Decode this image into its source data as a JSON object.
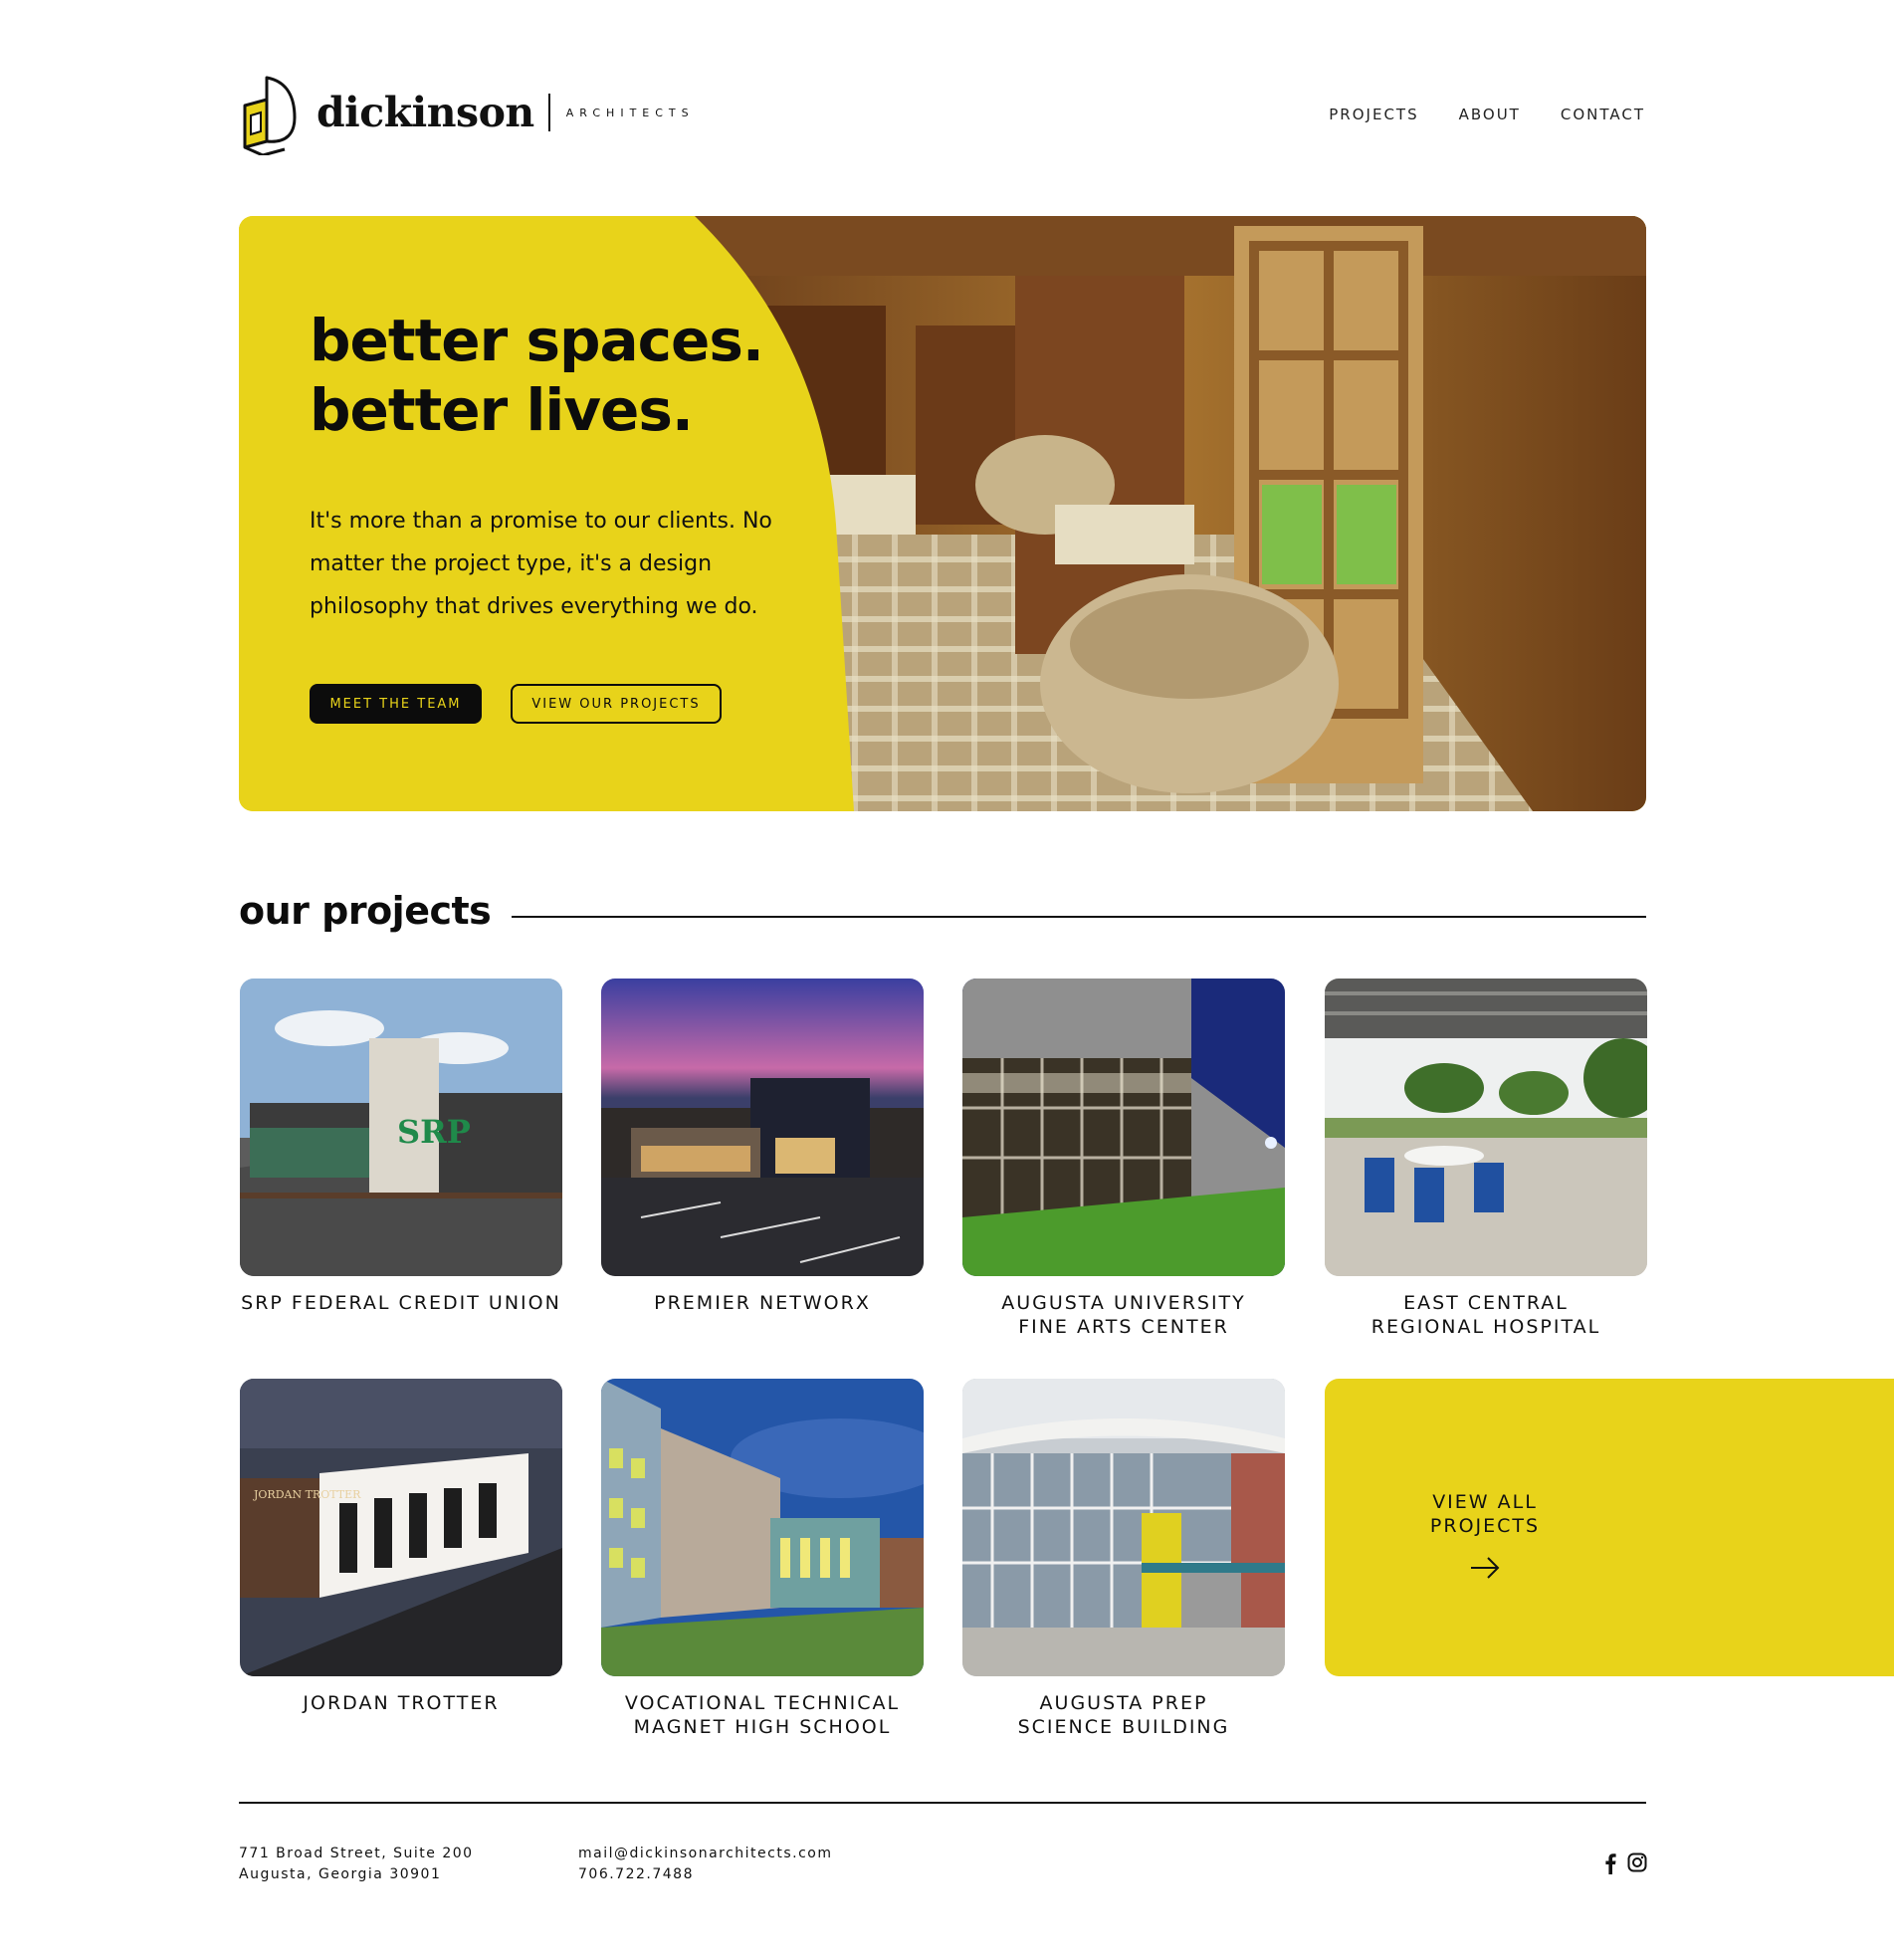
{
  "brand": {
    "name": "dickinson",
    "sub": "ARCHITECTS"
  },
  "nav": {
    "projects": "PROJECTS",
    "about": "ABOUT",
    "contact": "CONTACT"
  },
  "hero": {
    "title_line1": "better spaces.",
    "title_line2": "better lives.",
    "copy": "It's more than a promise to our clients. No matter the project type, it's a design philosophy that drives everything we do.",
    "btn_team": "MEET THE TEAM",
    "btn_projects": "VIEW OUR PROJECTS"
  },
  "projects_section": {
    "title": "our projects",
    "items": [
      {
        "label": "SRP FEDERAL CREDIT UNION"
      },
      {
        "label": "PREMIER NETWORX"
      },
      {
        "label": "AUGUSTA UNIVERSITY\nFINE ARTS CENTER"
      },
      {
        "label": "EAST CENTRAL\nREGIONAL HOSPITAL"
      },
      {
        "label": "JORDAN TROTTER"
      },
      {
        "label": "VOCATIONAL TECHNICAL\nMAGNET HIGH SCHOOL"
      },
      {
        "label": "AUGUSTA PREP\nSCIENCE BUILDING"
      }
    ],
    "view_all": "VIEW ALL\nPROJECTS"
  },
  "footer": {
    "address_line1": "771 Broad Street, Suite 200",
    "address_line2": "Augusta, Georgia 30901",
    "email": "mail@dickinsonarchitects.com",
    "phone": "706.722.7488"
  },
  "icons": {
    "facebook": "facebook-icon",
    "instagram": "instagram-icon",
    "arrow": "arrow-right-icon"
  },
  "colors": {
    "accent": "#e8d31a",
    "ink": "#0c0c0c"
  }
}
